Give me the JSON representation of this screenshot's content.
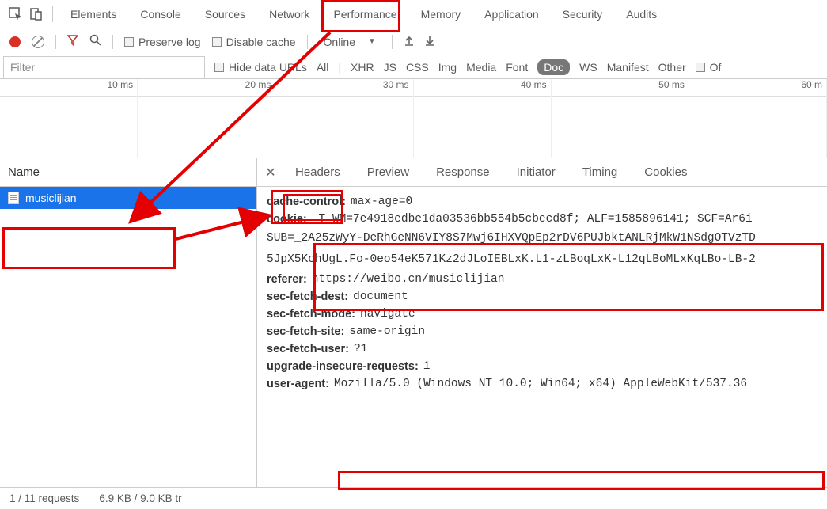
{
  "top_tabs": {
    "items": [
      "Elements",
      "Console",
      "Sources",
      "Network",
      "Performance",
      "Memory",
      "Application",
      "Security",
      "Audits"
    ],
    "active_index": 3
  },
  "toolbar": {
    "preserve_log_label": "Preserve log",
    "disable_cache_label": "Disable cache",
    "throttling_value": "Online"
  },
  "filter_row": {
    "filter_placeholder": "Filter",
    "hide_data_urls_label": "Hide data URLs",
    "categories": [
      "All",
      "XHR",
      "JS",
      "CSS",
      "Img",
      "Media",
      "Font",
      "Doc",
      "WS",
      "Manifest",
      "Other"
    ],
    "active_category": "Doc",
    "offline_label": "Of"
  },
  "timeline": {
    "ticks": [
      "10 ms",
      "20 ms",
      "30 ms",
      "40 ms",
      "50 ms",
      "60 m"
    ]
  },
  "left_pane": {
    "header": "Name",
    "requests": [
      {
        "name": "musiclijian",
        "type": "doc",
        "selected": true
      }
    ]
  },
  "detail": {
    "tabs": [
      "Headers",
      "Preview",
      "Response",
      "Initiator",
      "Timing",
      "Cookies"
    ],
    "active_tab_index": 0,
    "headers": {
      "cache_control_k": "cache-control:",
      "cache_control_v": "max-age=0",
      "cookie_k": "cookie:",
      "cookie_line1": "_T_WM=7e4918edbe1da03536bb554b5cbecd8f; ALF=1585896141; SCF=Ar6i",
      "cookie_line2": "SUB=_2A25zWyY-DeRhGeNN6VIY8S7Mwj6IHXVQpEp2rDV6PUJbktANLRjMkW1NSdgOTVzTD",
      "cookie_line3": "5JpX5KchUgL.Fo-0eo54eK571Kz2dJLoIEBLxK.L1-zLBoqLxK-L12qLBoMLxKqLBo-LB-2",
      "referer_k": "referer:",
      "referer_v": "https://weibo.cn/musiclijian",
      "sec_fetch_dest_k": "sec-fetch-dest:",
      "sec_fetch_dest_v": "document",
      "sec_fetch_mode_k": "sec-fetch-mode:",
      "sec_fetch_mode_v": "navigate",
      "sec_fetch_site_k": "sec-fetch-site:",
      "sec_fetch_site_v": "same-origin",
      "sec_fetch_user_k": "sec-fetch-user:",
      "sec_fetch_user_v": "?1",
      "upgrade_k": "upgrade-insecure-requests:",
      "upgrade_v": "1",
      "user_agent_k": "user-agent:",
      "user_agent_v": "Mozilla/5.0 (Windows NT 10.0; Win64; x64) AppleWebKit/537.36"
    }
  },
  "status_bar": {
    "requests": "1 / 11 requests",
    "transfer": "6.9 KB / 9.0 KB tr"
  }
}
